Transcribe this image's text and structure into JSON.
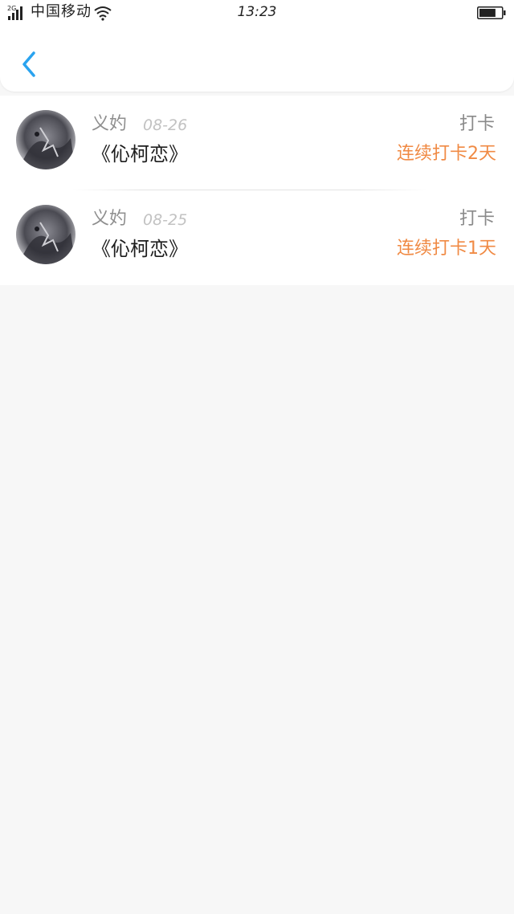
{
  "status_bar": {
    "network": "2G",
    "carrier": "中国移动",
    "time": "13:23",
    "battery_level": 0.75
  },
  "nav": {
    "back_icon": "chevron-left-icon",
    "accent": "#2aa3ef"
  },
  "records": [
    {
      "user": "义妁",
      "date": "08-26",
      "title": "《伈柯恋》",
      "action": "打卡",
      "streak": "连续打卡2天"
    },
    {
      "user": "义妁",
      "date": "08-25",
      "title": "《伈柯恋》",
      "action": "打卡",
      "streak": "连续打卡1天"
    }
  ],
  "colors": {
    "streak": "#f08a44",
    "background": "#f7f7f7"
  }
}
